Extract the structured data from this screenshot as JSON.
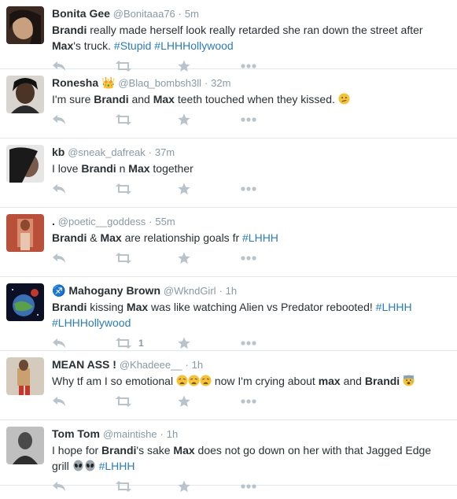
{
  "colors": {
    "link": "#2b7bb9",
    "muted": "#8899a6",
    "icon": "#b8c3cb",
    "divider": "#e1e8ed"
  },
  "icons": [
    "reply-icon",
    "retweet-icon",
    "favorite-star-icon",
    "more-dots-icon"
  ],
  "tweets": [
    {
      "name": "Bonita Gee",
      "handle": "@Bonitaaa76",
      "time": "5m",
      "body": [
        {
          "t": "Brandi",
          "s": "b"
        },
        {
          "t": " really made herself look really retarded she ran down the street after ",
          "s": ""
        },
        {
          "t": "Max",
          "s": "b"
        },
        {
          "t": "'s truck. ",
          "s": ""
        },
        {
          "t": "#Stupid",
          "s": "tag"
        },
        {
          "t": " ",
          "s": ""
        },
        {
          "t": "#LHHHollywood",
          "s": "tag"
        }
      ],
      "retweets": ""
    },
    {
      "name": "Ronesha 👑",
      "handle": "@Blaq_bombsh3ll",
      "time": "32m",
      "body": [
        {
          "t": "I'm sure ",
          "s": ""
        },
        {
          "t": "Brandi",
          "s": "b"
        },
        {
          "t": " and ",
          "s": ""
        },
        {
          "t": "Max",
          "s": "b"
        },
        {
          "t": "  teeth touched when they kissed. ",
          "s": ""
        },
        {
          "t": "confused-face",
          "s": "emoji"
        }
      ],
      "retweets": ""
    },
    {
      "name": "kb",
      "handle": "@sneak_dafreak",
      "time": "37m",
      "body": [
        {
          "t": "I love ",
          "s": ""
        },
        {
          "t": "Brandi",
          "s": "b"
        },
        {
          "t": " n ",
          "s": ""
        },
        {
          "t": "Max",
          "s": "b"
        },
        {
          "t": " together",
          "s": ""
        }
      ],
      "retweets": ""
    },
    {
      "name": ".",
      "handle": "@poetic__goddess",
      "time": "55m",
      "body": [
        {
          "t": "Brandi",
          "s": "b"
        },
        {
          "t": " & ",
          "s": ""
        },
        {
          "t": "Max",
          "s": "b"
        },
        {
          "t": " are relationship goals fr ",
          "s": ""
        },
        {
          "t": "#LHHH",
          "s": "tag"
        }
      ],
      "retweets": ""
    },
    {
      "name": "♐ Mahogany Brown",
      "handle": "@WkndGirl",
      "time": "1h",
      "body": [
        {
          "t": "Brandi",
          "s": "b"
        },
        {
          "t": " kissing ",
          "s": ""
        },
        {
          "t": "Max",
          "s": "b"
        },
        {
          "t": " was like watching Alien vs Predator rebooted! ",
          "s": ""
        },
        {
          "t": "#LHHH",
          "s": "tag"
        },
        {
          "t": " ",
          "s": ""
        },
        {
          "t": "#LHHHollywood",
          "s": "tag"
        }
      ],
      "retweets": "1"
    },
    {
      "name": "MEAN ASS !",
      "handle": "@Khadeee__",
      "time": "1h",
      "body": [
        {
          "t": "Why tf am I so emotional ",
          "s": ""
        },
        {
          "t": "weary-face",
          "s": "emoji"
        },
        {
          "t": "weary-face",
          "s": "emoji"
        },
        {
          "t": "weary-face",
          "s": "emoji"
        },
        {
          "t": " now I'm crying about ",
          "s": ""
        },
        {
          "t": "max",
          "s": "b"
        },
        {
          "t": " and ",
          "s": ""
        },
        {
          "t": "Brandi",
          "s": "b"
        },
        {
          "t": " ",
          "s": ""
        },
        {
          "t": "fearful-face",
          "s": "emoji"
        }
      ],
      "retweets": ""
    },
    {
      "name": "Tom Tom",
      "handle": "@maintishe",
      "time": "1h",
      "body": [
        {
          "t": "I hope for ",
          "s": ""
        },
        {
          "t": "Brandi",
          "s": "b"
        },
        {
          "t": "'s sake ",
          "s": ""
        },
        {
          "t": "Max",
          "s": "b"
        },
        {
          "t": " does not go down on her with that Jagged Edge grill ",
          "s": ""
        },
        {
          "t": "alien-face",
          "s": "emoji"
        },
        {
          "t": "alien-face",
          "s": "emoji"
        },
        {
          "t": " ",
          "s": ""
        },
        {
          "t": "#LHHH",
          "s": "tag"
        }
      ],
      "retweets": ""
    }
  ]
}
